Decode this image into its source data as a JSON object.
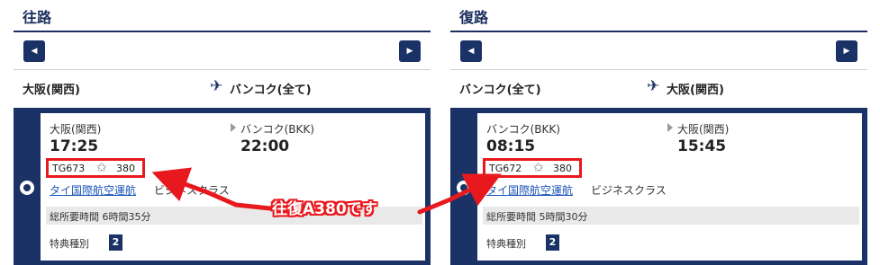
{
  "outbound": {
    "title": "往路",
    "from": "大阪(関西)",
    "to": "バンコク(全て)",
    "departure_city": "大阪(関西)",
    "arrival_city": "バンコク(BKK)",
    "departure_time": "17:25",
    "arrival_time": "22:00",
    "flight_number": "TG673",
    "aircraft": "380",
    "airline": "タイ国際航空運航",
    "cabin": "ビジネスクラス",
    "duration": "総所要時間 6時間35分",
    "award_label": "特典種別",
    "award_type": "2"
  },
  "return": {
    "title": "復路",
    "from": "バンコク(全て)",
    "to": "大阪(関西)",
    "departure_city": "バンコク(BKK)",
    "arrival_city": "大阪(関西)",
    "departure_time": "08:15",
    "arrival_time": "15:45",
    "flight_number": "TG672",
    "aircraft": "380",
    "airline": "タイ国際航空運航",
    "cabin": "ビジネスクラス",
    "duration": "総所要時間 5時間30分",
    "award_label": "特典種別",
    "award_type": "2"
  },
  "annotation": {
    "text": "往復A380です",
    "color": "#e8191e"
  },
  "icons": {
    "prev": "◀",
    "next": "▶",
    "plane": "✈",
    "star": "✩"
  },
  "colors": {
    "navy": "#1b3266",
    "highlight": "#e8191e",
    "link": "#1a56b8"
  }
}
